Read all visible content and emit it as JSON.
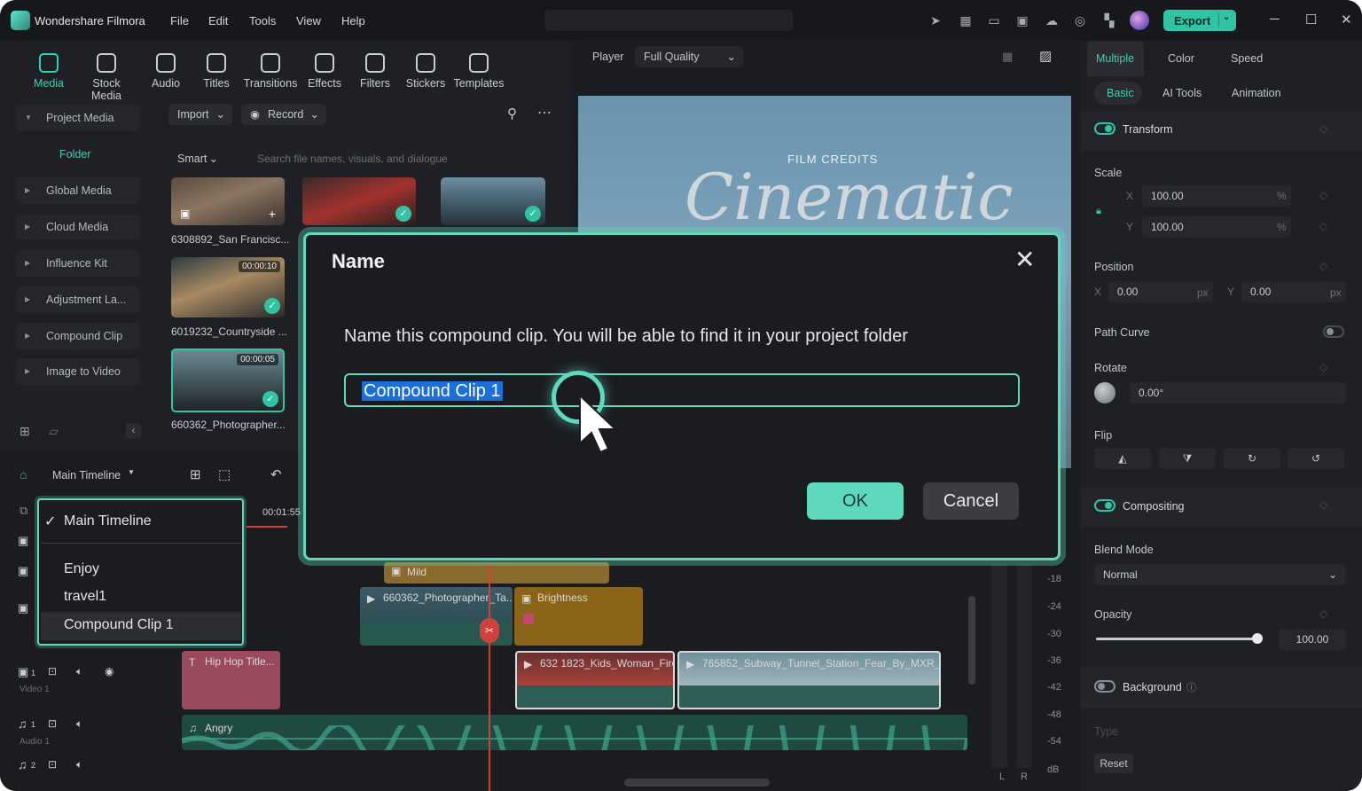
{
  "app": {
    "name": "Wondershare Filmora"
  },
  "menubar": [
    "File",
    "Edit",
    "Tools",
    "View",
    "Help"
  ],
  "export_label": "Export",
  "media_tabs": [
    "Media",
    "Stock Media",
    "Audio",
    "Titles",
    "Transitions",
    "Effects",
    "Filters",
    "Stickers",
    "Templates"
  ],
  "sidebar": {
    "items": [
      "Project Media",
      "Global Media",
      "Cloud Media",
      "Influence Kit",
      "Adjustment La...",
      "Compound Clip",
      "Image to Video"
    ],
    "folder": "Folder"
  },
  "media_toolbar": {
    "import": "Import",
    "record": "Record",
    "smart": "Smart",
    "search_placeholder": "Search file names, visuals, and dialogue"
  },
  "media_items": [
    {
      "name": "6308892_San Francisc...",
      "duration": ""
    },
    {
      "name": "6019232_Countryside ...",
      "duration": "00:00:10"
    },
    {
      "name": "660362_Photographer...",
      "duration": "00:00:05"
    }
  ],
  "player": {
    "label": "Player",
    "quality": "Full Quality",
    "overlay_small": "FILM CREDITS",
    "overlay_big": "Cinematic"
  },
  "right_tabs": [
    "Multiple",
    "Color",
    "Speed"
  ],
  "right_subtabs": [
    "Basic",
    "AI Tools",
    "Animation"
  ],
  "transform": {
    "title": "Transform",
    "scale_label": "Scale",
    "scale_x": "100.00",
    "scale_y": "100.00",
    "percent": "%",
    "position_label": "Position",
    "pos_x": "0.00",
    "pos_y": "0.00",
    "px": "px",
    "path_curve": "Path Curve",
    "rotate_label": "Rotate",
    "rotate_value": "0.00°",
    "flip_label": "Flip",
    "x": "X",
    "y": "Y"
  },
  "compositing": {
    "title": "Compositing",
    "blend_label": "Blend Mode",
    "blend_value": "Normal",
    "opacity_label": "Opacity",
    "opacity_value": "100.00"
  },
  "background": {
    "title": "Background",
    "type_label": "Type"
  },
  "reset_label": "Reset",
  "timeline": {
    "selector": "Main Timeline",
    "timecode": "00:01:55",
    "tracks": [
      {
        "label": "Video 1",
        "number": "1"
      },
      {
        "label": "Audio 1",
        "number": "1"
      },
      {
        "number": "2"
      }
    ],
    "clips": {
      "mild": "Mild",
      "photographer": "660362_Photographer_Ta...",
      "brightness": "Brightness",
      "hiphop": "Hip Hop Title...",
      "kids": "632 1823_Kids_Woman_Fire...",
      "subway": "765852_Subway_Tunnel_Station_Fear_By_MXR_Pr...",
      "audio": "Angry"
    },
    "meter_ticks": [
      "-18",
      "-24",
      "-30",
      "-36",
      "-42",
      "-48",
      "-54",
      "dB"
    ],
    "meter_lr": [
      "L",
      "R"
    ]
  },
  "timeline_menu": {
    "items": [
      "Main Timeline",
      "Enjoy",
      "travel1",
      "Compound Clip 1"
    ],
    "checked": "Main Timeline",
    "highlighted": "Compound Clip 1"
  },
  "dialog": {
    "title": "Name",
    "message": "Name this compound clip. You will be able to find it in your project folder",
    "input_value": "Compound Clip 1",
    "ok": "OK",
    "cancel": "Cancel"
  },
  "colors": {
    "accent": "#2fc4a3",
    "highlight": "#5fd9be",
    "selection": "#1a6fd8"
  }
}
